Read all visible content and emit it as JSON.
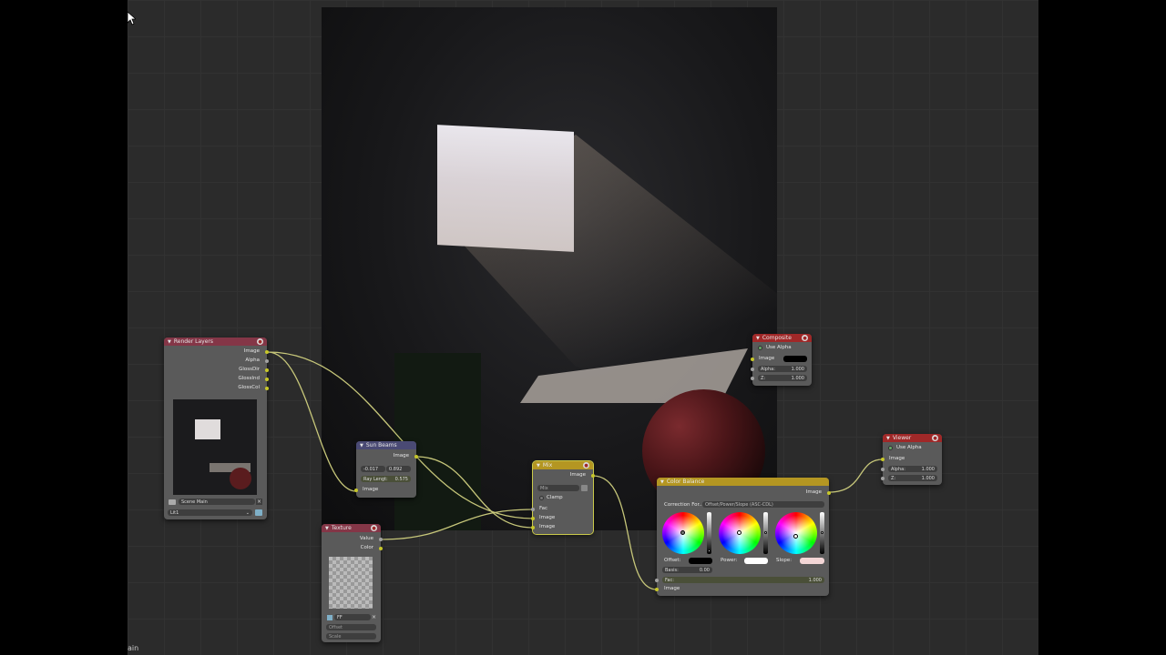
{
  "colors": {
    "render_layers_header": "#843647",
    "sun_beams_header": "#4a4a74",
    "texture_header": "#843647",
    "mix_header": "#b49622",
    "color_balance_header": "#b49622",
    "composite_header": "#a02828",
    "viewer_header": "#a02828",
    "link": "#c7c77a"
  },
  "render_layers": {
    "title": "Render Layers",
    "outputs": [
      "Image",
      "Alpha",
      "GlossDir",
      "GlossInd",
      "GlossCol"
    ],
    "scene": "Scene Main",
    "layer": "Lit1"
  },
  "sun_beams": {
    "title": "Sun Beams",
    "out": "Image",
    "x": "-0.017",
    "y": "0.892",
    "ray_label": "Ray Lengt:",
    "ray_value": "0.575",
    "in": "Image"
  },
  "texture": {
    "title": "Texture",
    "outputs": [
      "Value",
      "Color"
    ],
    "tex_name": "FF",
    "offset": "Offset",
    "scale": "Scale"
  },
  "mix": {
    "title": "Mix",
    "out": "Image",
    "mode": "Mix",
    "clamp": "Clamp",
    "fac": "Fac",
    "in1": "Image",
    "in2": "Image"
  },
  "color_balance": {
    "title": "Color Balance",
    "out": "Image",
    "correction_label": "Correction For...",
    "correction_value": "Offset/Power/Slope (ASC-CDL)",
    "offset": "Offset:",
    "power": "Power:",
    "slope": "Slope:",
    "basis_label": "Basis:",
    "basis_value": "0.00",
    "fac_label": "Fac:",
    "fac_value": "1.000",
    "in": "Image"
  },
  "composite": {
    "title": "Composite",
    "use_alpha": "Use Alpha",
    "image": "Image",
    "alpha_label": "Alpha:",
    "alpha_value": "1.000",
    "z_label": "Z:",
    "z_value": "1.000"
  },
  "viewer": {
    "title": "Viewer",
    "use_alpha": "Use Alpha",
    "image": "Image",
    "alpha_label": "Alpha:",
    "alpha_value": "1.000",
    "z_label": "Z:",
    "z_value": "1.000"
  },
  "corner_text": "ain"
}
